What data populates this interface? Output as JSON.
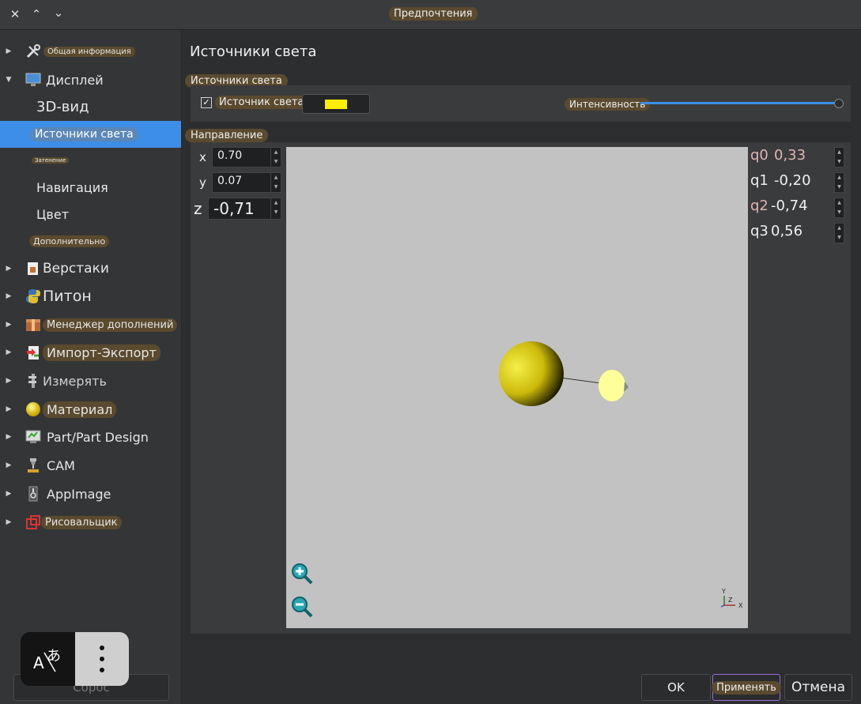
{
  "window": {
    "title": "Предпочтения",
    "controls": [
      "close-icon",
      "chevron-up-icon",
      "chevron-down-icon"
    ]
  },
  "sidebar": {
    "items": [
      {
        "label": "Общая информация",
        "icon": "tools-icon",
        "expanded": false
      },
      {
        "label": "Дисплей",
        "icon": "monitor-icon",
        "expanded": true
      },
      {
        "label": "3D-вид",
        "child": true
      },
      {
        "label": "Источники света",
        "child": true,
        "selected": true
      },
      {
        "label": "Затенение",
        "child": true
      },
      {
        "label": "Навигация",
        "child": true
      },
      {
        "label": "Цвет",
        "child": true
      },
      {
        "label": "Дополнительно",
        "child": true
      },
      {
        "label": "Верстаки",
        "icon": "workbench-icon",
        "expanded": false
      },
      {
        "label": "Питон",
        "icon": "python-icon",
        "expanded": false
      },
      {
        "label": "Менеджер дополнений",
        "icon": "package-icon",
        "expanded": false
      },
      {
        "label": "Импорт-Экспорт",
        "icon": "import-export-icon",
        "expanded": false
      },
      {
        "label": "Измерять",
        "icon": "measure-icon",
        "expanded": false
      },
      {
        "label": "Материал",
        "icon": "material-sphere-icon",
        "expanded": false
      },
      {
        "label": "Part/Part Design",
        "icon": "part-design-icon",
        "expanded": false
      },
      {
        "label": "CAM",
        "icon": "cam-icon",
        "expanded": false
      },
      {
        "label": "AppImage",
        "icon": "appimage-icon",
        "expanded": false
      },
      {
        "label": "Рисовальщик",
        "icon": "draft-icon",
        "expanded": false
      }
    ]
  },
  "main": {
    "title": "Источники света",
    "light_group": {
      "label": "Источники света",
      "checkbox_label": "Источник света",
      "checked": true,
      "light_color": "#ffee00",
      "intensity_label": "Интенсивность",
      "intensity_fraction": 1.0
    },
    "direction_group": {
      "label": "Направление",
      "x_label": "x",
      "x_value": "0.70",
      "y_label": "y",
      "y_value": "0.07",
      "z_label": "z",
      "z_value": "-0,71",
      "axis_indicator": {
        "y": "Y",
        "z": "Z",
        "x": "X"
      }
    },
    "quaternion": [
      {
        "label": "q0",
        "value": "0,33",
        "color": "#e0b3b3"
      },
      {
        "label": "q1",
        "value": "-0,20",
        "color": "#f0f0f0"
      },
      {
        "label": "q2",
        "value": "-0,74",
        "color": "#e0b3b3"
      },
      {
        "label": "q3",
        "value": "0,56",
        "color": "#f0f0f0"
      }
    ]
  },
  "buttons": {
    "reset": "Сброс",
    "ok": "OK",
    "apply": "Применять",
    "cancel": "Отмена"
  },
  "overlay": {
    "translate_icon": "translate-icon",
    "menu_icon": "more-vert-icon"
  }
}
